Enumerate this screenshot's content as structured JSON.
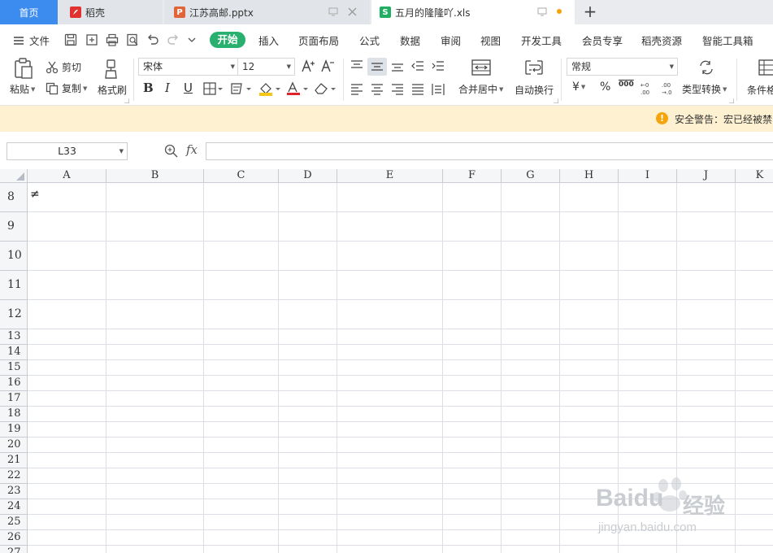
{
  "tabs": {
    "home": "首页",
    "items": [
      {
        "label": "稻壳",
        "icon": "docer-icon"
      },
      {
        "label": "江苏高邮.pptx",
        "icon": "pptx-file-icon"
      },
      {
        "label": "五月的隆隆吖.xls",
        "icon": "spreadsheet-file-icon"
      }
    ],
    "add": "+"
  },
  "menu": {
    "file": "文件",
    "items": [
      "开始",
      "插入",
      "页面布局",
      "公式",
      "数据",
      "审阅",
      "视图",
      "开发工具",
      "会员专享",
      "稻壳资源",
      "智能工具箱"
    ]
  },
  "ribbon": {
    "paste": "粘贴",
    "cut": "剪切",
    "copy": "复制",
    "format_painter": "格式刷",
    "font_name": "宋体",
    "font_size": "12",
    "merge_center": "合并居中",
    "wrap_text": "自动换行",
    "number_format": "常规",
    "currency": "¥",
    "percent": "%",
    "thousands": "000",
    "type_convert": "类型转换",
    "conditional_format": "条件格"
  },
  "warning": {
    "icon": "!",
    "text": "安全警告：宏已经被禁"
  },
  "formula_bar": {
    "cell_ref": "L33",
    "fx": "fx",
    "formula": ""
  },
  "grid": {
    "columns": [
      "A",
      "B",
      "C",
      "D",
      "E",
      "F",
      "G",
      "H",
      "I",
      "J",
      "K"
    ],
    "rows": [
      "8",
      "9",
      "10",
      "11",
      "12",
      "13",
      "14",
      "15",
      "16",
      "17",
      "18",
      "19",
      "20",
      "21",
      "22",
      "23",
      "24",
      "25",
      "26",
      "27"
    ],
    "cells": [
      {
        "ref": "A8",
        "value": "≠"
      }
    ]
  },
  "watermark": {
    "brand": "Baidu",
    "cn": "经验",
    "url": "jingyan.baidu.com"
  }
}
